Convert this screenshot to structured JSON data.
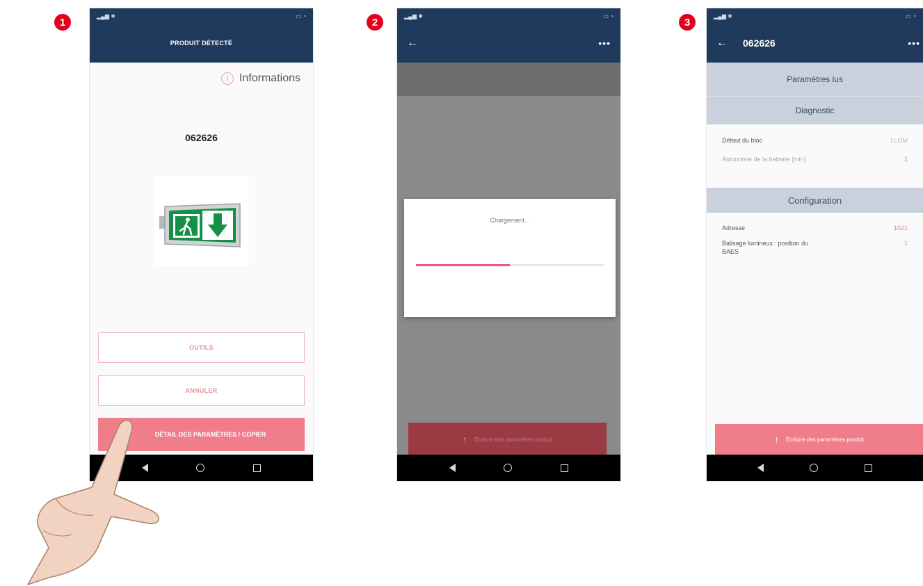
{
  "steps": [
    "1",
    "2",
    "3"
  ],
  "screen1": {
    "title": "PRODUIT DÉTECTÉ",
    "info_label": "Informations",
    "product_code": "062626",
    "buttons": {
      "tools": "OUTILS",
      "cancel": "ANNULER",
      "detail": "DÉTAIL DES PARAMÈTRES / COPIER"
    }
  },
  "screen2": {
    "loading_text": "Chargement...",
    "progress": 0.5,
    "write_button": "Écriture des paramètres produit"
  },
  "screen3": {
    "title": "062626",
    "header_read": "Paramètres lus",
    "section_diagnostic": "Diagnostic",
    "rows_diagnostic": [
      {
        "label": "Défaut du bloc",
        "value": "LLOM"
      },
      {
        "label": "Autonomie de la batterie (min)",
        "value": "1"
      }
    ],
    "section_config": "Configuration",
    "rows_config": [
      {
        "label": "Adresse",
        "value": "1021"
      },
      {
        "label": "Balisage lumineux : position du BAES",
        "value": "1"
      }
    ],
    "write_button": "Écriture des paramètres produit"
  },
  "colors": {
    "appbar": "#1f3a5c",
    "accent": "#f07e8a",
    "badge": "#e3001b"
  }
}
